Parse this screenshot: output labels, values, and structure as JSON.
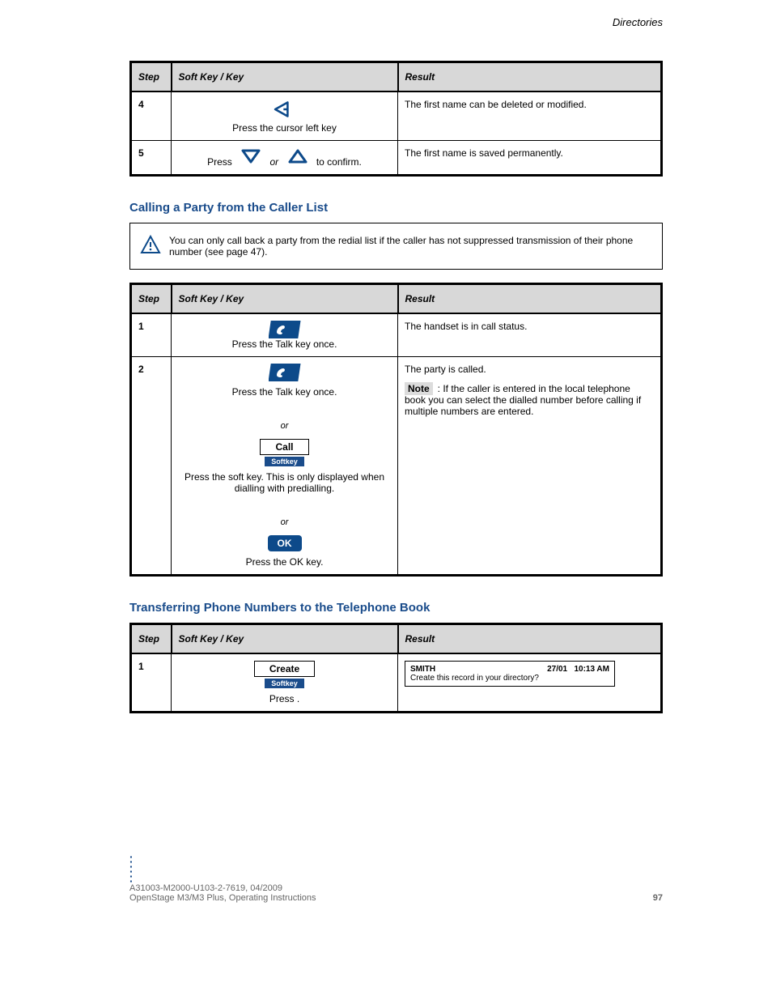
{
  "page_title_top": "Directories",
  "table1": {
    "headers": {
      "step": "Step",
      "key": "Soft Key / Key",
      "result": "Result"
    },
    "rows": [
      {
        "num": "4",
        "key_text": "Press the cursor left key",
        "result": "The first name can be deleted or modified."
      },
      {
        "num": "5",
        "key_prefix": "Press ",
        "key_or": " or ",
        "key_suffix": " to confirm.",
        "result": "The first name is saved permanently."
      }
    ]
  },
  "section_call": {
    "heading": "Calling a Party from the Caller List",
    "note_text": "You can only call back a party from the redial list if the caller has not suppressed transmission of their phone number (see page 47).",
    "headers": {
      "step": "Step",
      "key": "Soft Key / Key",
      "result": "Result"
    },
    "rows": [
      {
        "num": "1",
        "key_text": "Press the Talk key once.",
        "result": "The handset is in call status."
      },
      {
        "num": "2",
        "key_text_a": "Press the Talk key once.",
        "or": "or",
        "call_label": "Call",
        "softkey_label": "Softkey",
        "or2": "or",
        "ok_label": "OK",
        "key_text_b": "Press the   soft key. This is only displayed when dialling with predialling.",
        "key_text_c": "Press the OK key.",
        "result_prefix": "The party is called.",
        "note_tag": "Note",
        "note_body": ": If the caller is entered in the local telephone book you can select the dialled number before calling if multiple numbers are entered."
      }
    ]
  },
  "section_transfer": {
    "heading": "Transferring Phone Numbers to the Telephone Book",
    "headers": {
      "step": "Step",
      "key": "Soft Key / Key",
      "result": "Result"
    },
    "row": {
      "num": "1",
      "create_label": "Create",
      "softkey_label": "Softkey",
      "key_text": "Press  .",
      "screen_name": "SMITH",
      "screen_date": "27/01",
      "screen_time": "10:13 AM",
      "screen_msg": "Create this record in your directory?"
    }
  },
  "footer": {
    "doc": "A31003-M2000-U103-2-7619, 04/2009",
    "product": "OpenStage M3/M3 Plus, Operating Instructions",
    "page": "97"
  }
}
